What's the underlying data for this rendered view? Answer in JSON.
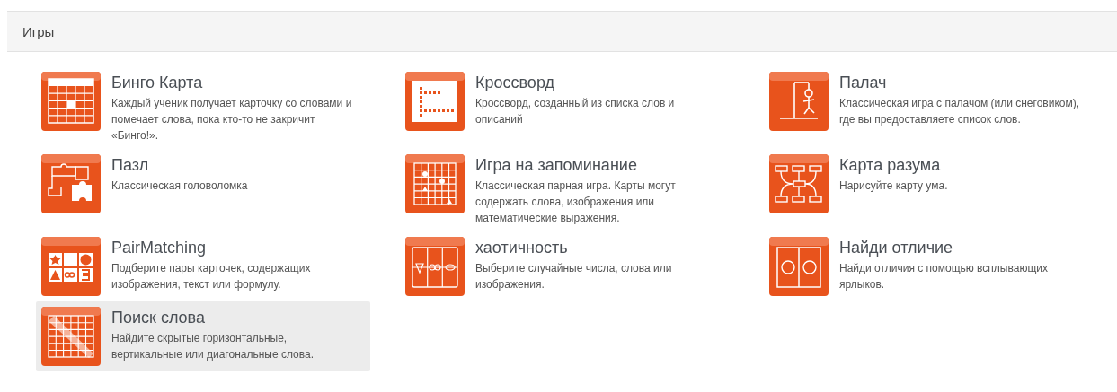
{
  "header": {
    "title": "Игры"
  },
  "games": [
    {
      "kind": "bingo",
      "title": "Бинго Карта",
      "description": "Каждый ученик получает карточку со словами и помечает слова, пока кто-то не закричит «Бинго!».",
      "selected": false
    },
    {
      "kind": "crossword",
      "title": "Кроссворд",
      "description": "Кроссворд, созданный из списка слов и описаний",
      "selected": false
    },
    {
      "kind": "hangman",
      "title": "Палач",
      "description": "Классическая игра с палачом (или снеговиком), где вы предоставляете список слов.",
      "selected": false
    },
    {
      "kind": "puzzle",
      "title": "Пазл",
      "description": "Классическая головоломка",
      "selected": false
    },
    {
      "kind": "memory",
      "title": "Игра на запоминание",
      "description": "Классическая парная игра. Карты могут содержать слова, изображения или математические выражения.",
      "selected": false
    },
    {
      "kind": "mindmap",
      "title": "Карта разума",
      "description": "Нарисуйте карту ума.",
      "selected": false
    },
    {
      "kind": "pairs",
      "title": "PairMatching",
      "description": "Подберите пары карточек, содержащих изображения, текст или формулу.",
      "selected": false
    },
    {
      "kind": "chaos",
      "title": "хаотичность",
      "description": "Выберите случайные числа, слова или изображения.",
      "selected": false
    },
    {
      "kind": "difference",
      "title": "Найди отличие",
      "description": "Найди отличия с помощью всплывающих ярлыков.",
      "selected": false
    },
    {
      "kind": "wordsearch",
      "title": "Поиск слова",
      "description": "Найдите скрытые горизонтальные, вертикальные или диагональные слова.",
      "selected": true
    }
  ]
}
